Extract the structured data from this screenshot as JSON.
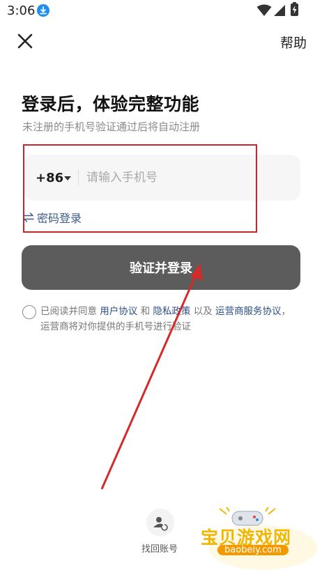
{
  "status_bar": {
    "time": "3:06"
  },
  "header": {
    "close_icon": "close-icon",
    "help_label": "帮助"
  },
  "heading": {
    "title": "登录后，体验完整功能",
    "subtitle": "未注册的手机号验证通过后将自动注册"
  },
  "phone": {
    "country_code": "+86",
    "placeholder": "请输入手机号",
    "value": ""
  },
  "password_login_label": "密码登录",
  "login_button_label": "验证并登录",
  "agreement": {
    "prefix": "已阅读并同意",
    "user_agreement": "用户协议",
    "and": "和",
    "privacy_policy": "隐私政策",
    "and2": "以及",
    "operator_agreement": "运营商服务协议",
    "comma": "，",
    "line2": "运营商将对你提供的手机号进行验证",
    "checked": false
  },
  "recover": {
    "label": "找回账号",
    "icon": "user-refresh-icon"
  },
  "watermark": {
    "text": "宝贝游戏网",
    "url": "baobeiy.com"
  },
  "colors": {
    "annotation": "#c9232c",
    "button": "#5c5c5c",
    "link": "#2e4e84",
    "watermark": "#f2b600"
  }
}
